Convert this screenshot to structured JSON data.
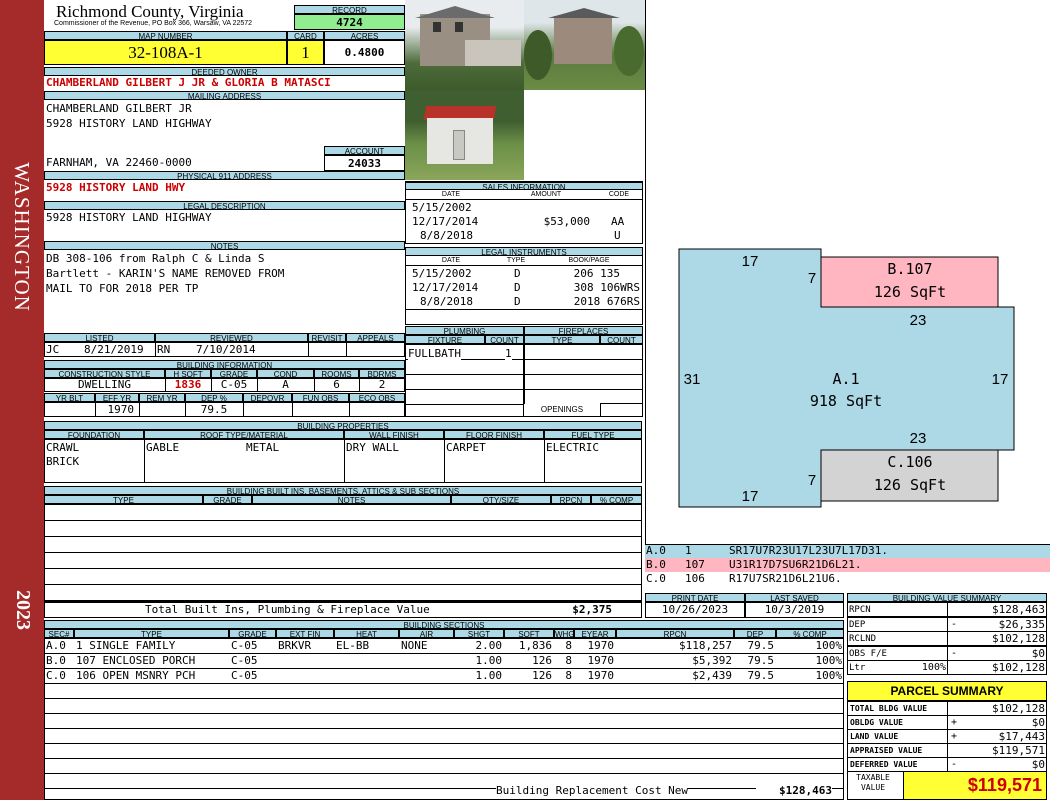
{
  "side": {
    "district": "WASHINGTON",
    "year": "2023"
  },
  "header": {
    "county": "Richmond County, Virginia",
    "commissioner": "Commissioner of the Revenue, PO Box 366, Warsaw, VA 22572",
    "record_label": "RECORD",
    "record": "4724",
    "map_label": "MAP NUMBER",
    "map_number": "32-108A-1",
    "card_label": "CARD",
    "card": "1",
    "acres_label": "ACRES",
    "acres": "0.4800"
  },
  "owner": {
    "deeded_label": "DEEDED OWNER",
    "deeded_owner": "CHAMBERLAND GILBERT J JR & GLORIA B MATASCI",
    "mailing_label": "MAILING ADDRESS",
    "mailing_lines": [
      "CHAMBERLAND GILBERT JR",
      "5928 HISTORY LAND HIGHWAY",
      "",
      "FARNHAM, VA 22460-0000"
    ],
    "account_label": "ACCOUNT",
    "account": "24033",
    "physical_label": "PHYSICAL 911 ADDRESS",
    "physical": "5928 HISTORY LAND HWY",
    "legal_label": "LEGAL DESCRIPTION",
    "legal": "5928 HISTORY LAND HIGHWAY",
    "notes_label": "NOTES",
    "notes_lines": [
      "DB 308-106 from Ralph C & Linda S",
      "Bartlett - KARIN'S NAME REMOVED FROM",
      "MAIL TO FOR 2018 PER TP"
    ]
  },
  "sales": {
    "title": "SALES INFORMATION",
    "headers": [
      "DATE",
      "AMOUNT",
      "CODE"
    ],
    "rows": [
      [
        "5/15/2002",
        "",
        ""
      ],
      [
        "12/17/2014",
        "$53,000",
        "AA"
      ],
      [
        "8/8/2018",
        "",
        "U"
      ]
    ]
  },
  "instruments": {
    "title": "LEGAL INSTRUMENTS",
    "headers": [
      "DATE",
      "TYPE",
      "BOOK/PAGE"
    ],
    "rows": [
      [
        "5/15/2002",
        "D",
        "206 135"
      ],
      [
        "12/17/2014",
        "D",
        "308 106WRS"
      ],
      [
        "8/8/2018",
        "D",
        "2018 676RS"
      ]
    ]
  },
  "review": {
    "headers": [
      "LISTED",
      "REVIEWED",
      "REVISIT",
      "APPEALS"
    ],
    "listed_by": "JC",
    "listed": "8/21/2019",
    "reviewed_by": "RN",
    "reviewed": "7/10/2014"
  },
  "building_info": {
    "title": "BUILDING INFORMATION",
    "headers": [
      "CONSTRUCTION STYLE",
      "H SQFT",
      "GRADE",
      "COND",
      "ROOMS",
      "BDRMS"
    ],
    "values": [
      "DWELLING",
      "1836",
      "C-05",
      "A",
      "6",
      "2"
    ],
    "headers2": [
      "YR BLT",
      "EFF YR",
      "REM YR",
      "DEP %",
      "DEPOVR",
      "FUN OBS",
      "ECO OBS"
    ],
    "values2": [
      "",
      "1970",
      "",
      "79.5",
      "",
      "",
      ""
    ]
  },
  "plumbing": {
    "title": "PLUMBING",
    "headers": [
      "FIXTURE",
      "COUNT"
    ],
    "rows": [
      [
        "FULLBATH",
        "1"
      ]
    ]
  },
  "fireplaces": {
    "title": "FIREPLACES",
    "headers": [
      "TYPE",
      "COUNT"
    ],
    "openings": "OPENINGS"
  },
  "properties": {
    "title": "BUILDING PROPERTIES",
    "headers": [
      "FOUNDATION",
      "ROOF TYPE/MATERIAL",
      "WALL FINISH",
      "FLOOR FINISH",
      "FUEL TYPE"
    ],
    "foundation": [
      "CRAWL",
      "BRICK"
    ],
    "roof_type": "GABLE",
    "roof_material": "METAL",
    "wall": "DRY WALL",
    "floor": "CARPET",
    "fuel": "ELECTRIC"
  },
  "builtins": {
    "title": "BUILDING BUILT INS, BASEMENTS, ATTICS & SUB SECTIONS",
    "headers": [
      "TYPE",
      "GRADE",
      "NOTES",
      "QTY/SIZE",
      "RPCN",
      "% COMP"
    ],
    "total_label": "Total Built Ins, Plumbing & Fireplace Value",
    "total": "$2,375"
  },
  "sections": {
    "title": "BUILDING SECTIONS",
    "headers": [
      "SEC#",
      "TYPE",
      "GRADE",
      "EXT FIN",
      "HEAT",
      "AIR",
      "SHGT",
      "SQFT",
      "WHGT",
      "EYEAR",
      "RPCN",
      "DEP",
      "% COMP"
    ],
    "rows": [
      [
        "A.0",
        "1 SINGLE FAMILY",
        "C-05",
        "BRKVR",
        "EL-BB",
        "NONE",
        "2.00",
        "1,836",
        "8",
        "1970",
        "$118,257",
        "79.5",
        "100%"
      ],
      [
        "B.0",
        "107 ENCLOSED PORCH",
        "C-05",
        "",
        "",
        "",
        "1.00",
        "126",
        "8",
        "1970",
        "$5,392",
        "79.5",
        "100%"
      ],
      [
        "C.0",
        "106 OPEN MSNRY PCH",
        "C-05",
        "",
        "",
        "",
        "1.00",
        "126",
        "8",
        "1970",
        "$2,439",
        "79.5",
        "100%"
      ]
    ],
    "rcn_label": "Building Replacement Cost New",
    "rcn": "$128,463"
  },
  "sketch": {
    "a_label": "A.1",
    "a_area": "918 SqFt",
    "b_label": "B.107",
    "b_area": "126 SqFt",
    "c_label": "C.106",
    "c_area": "126 SqFt",
    "dims": {
      "top": "17",
      "left": "31",
      "right": "17",
      "b_side": "7",
      "b_bottom": "23",
      "c_top": "23",
      "c_side": "7",
      "bottom": "17"
    },
    "colors": {
      "a": "#add8e6",
      "b": "#ffb6c1",
      "c": "#d3d3d3"
    },
    "legend": [
      {
        "sec": "A.0",
        "code": "1",
        "path": "SR17U7R23U17L23U7L17D31."
      },
      {
        "sec": "B.0",
        "code": "107",
        "path": "U31R17D7SU6R21D6L21."
      },
      {
        "sec": "C.0",
        "code": "106",
        "path": "R17U7SR21D6L21U6."
      }
    ]
  },
  "dates": {
    "print_label": "PRINT DATE",
    "print": "10/26/2023",
    "saved_label": "LAST SAVED",
    "saved": "10/3/2019"
  },
  "value_summary": {
    "title": "BUILDING VALUE SUMMARY",
    "rows": [
      {
        "label": "RPCN",
        "sign": "",
        "value": "$128,463"
      },
      {
        "label": "DEP",
        "sign": "-",
        "value": "$26,335"
      },
      {
        "label": "RCLND",
        "sign": "",
        "value": "$102,128"
      },
      {
        "label": "OBS F/E",
        "sign": "-",
        "value": "$0"
      },
      {
        "label": "Ltr",
        "pct": "100%",
        "sign": "",
        "value": "$102,128"
      }
    ]
  },
  "parcel": {
    "title": "PARCEL SUMMARY",
    "rows": [
      {
        "label": "TOTAL BLDG VALUE",
        "sign": "",
        "value": "$102,128"
      },
      {
        "label": "OBLDG VALUE",
        "sign": "+",
        "value": "$0"
      },
      {
        "label": "LAND VALUE",
        "sign": "+",
        "value": "$17,443"
      },
      {
        "label": "APPRAISED VALUE",
        "sign": "",
        "value": "$119,571"
      },
      {
        "label": "DEFERRED VALUE",
        "sign": "-",
        "value": "$0"
      }
    ],
    "taxable_label": "TAXABLE VALUE",
    "taxable": "$119,571"
  }
}
